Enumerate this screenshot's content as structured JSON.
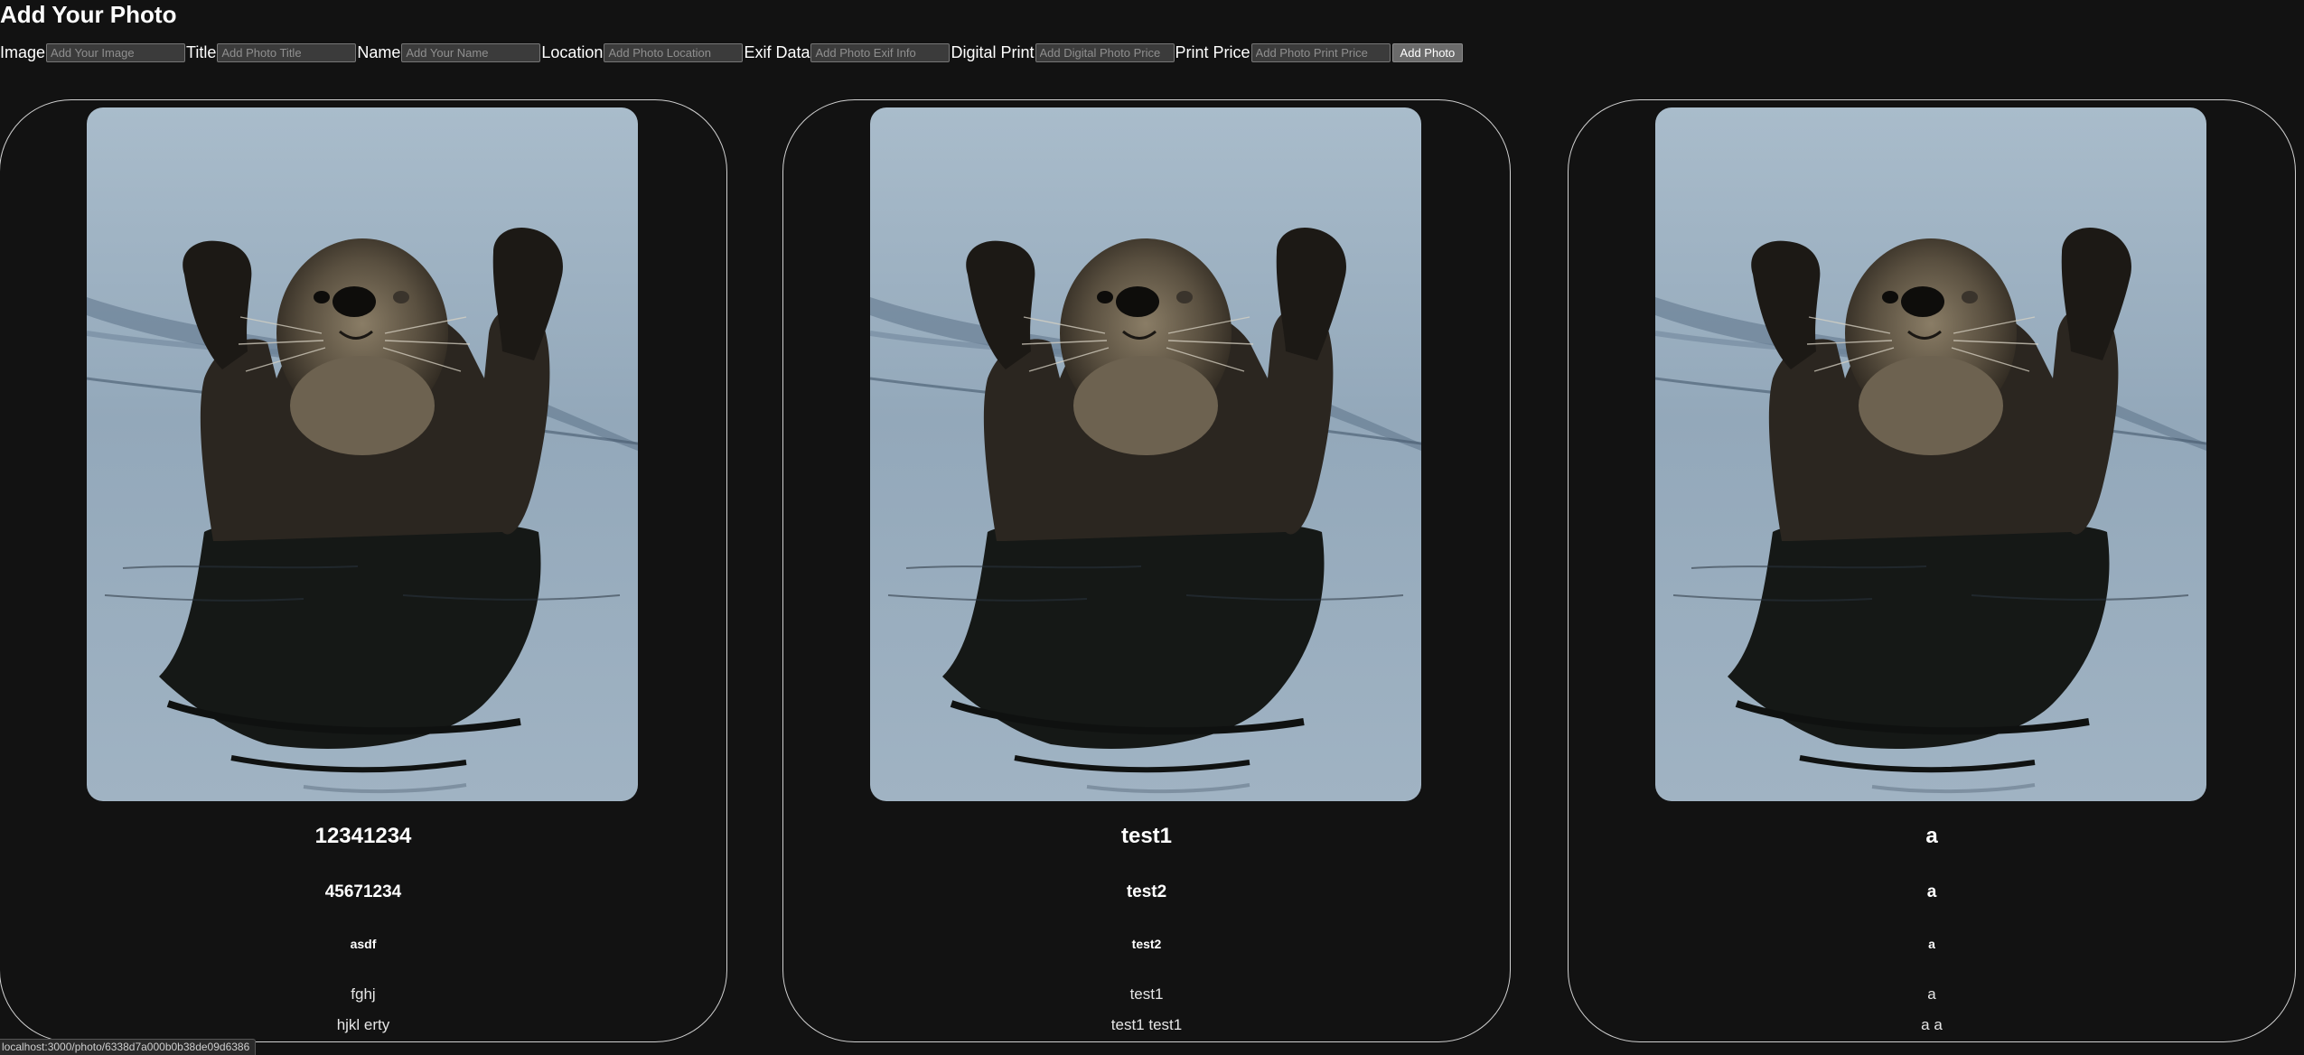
{
  "page": {
    "title": "Add Your Photo"
  },
  "form": {
    "image_label": "Image",
    "image_placeholder": "Add Your Image",
    "title_label": "Title",
    "title_placeholder": "Add Photo Title",
    "name_label": "Name",
    "name_placeholder": "Add Your Name",
    "location_label": "Location",
    "location_placeholder": "Add Photo Location",
    "exif_label": "Exif Data",
    "exif_placeholder": "Add Photo Exif Info",
    "digital_label": "Digital Print",
    "digital_placeholder": "Add Digital Photo Price",
    "print_label": "Print Price",
    "print_placeholder": "Add Photo Print Price",
    "submit_label": "Add Photo"
  },
  "cards": [
    {
      "title": "12341234",
      "name": "45671234",
      "location": "asdf",
      "exif": "fghj",
      "prices": "hjkl erty",
      "image_alt": "Sea otter raising its paws in the water"
    },
    {
      "title": "test1",
      "name": "test2",
      "location": "test2",
      "exif": "test1",
      "prices": "test1 test1",
      "image_alt": "Sea otter raising its paws in the water"
    },
    {
      "title": "a",
      "name": "a",
      "location": "a",
      "exif": "a",
      "prices": "a a",
      "image_alt": "Sea otter raising its paws in the water"
    }
  ],
  "status_bar": {
    "url": "localhost:3000/photo/6338d7a000b0b38de09d6386"
  },
  "colors": {
    "background": "#121212",
    "card_border": "#d0d0d0",
    "water": "#9db0c0",
    "otter_fur": "#2b2620",
    "button": "#6b6b6b"
  }
}
